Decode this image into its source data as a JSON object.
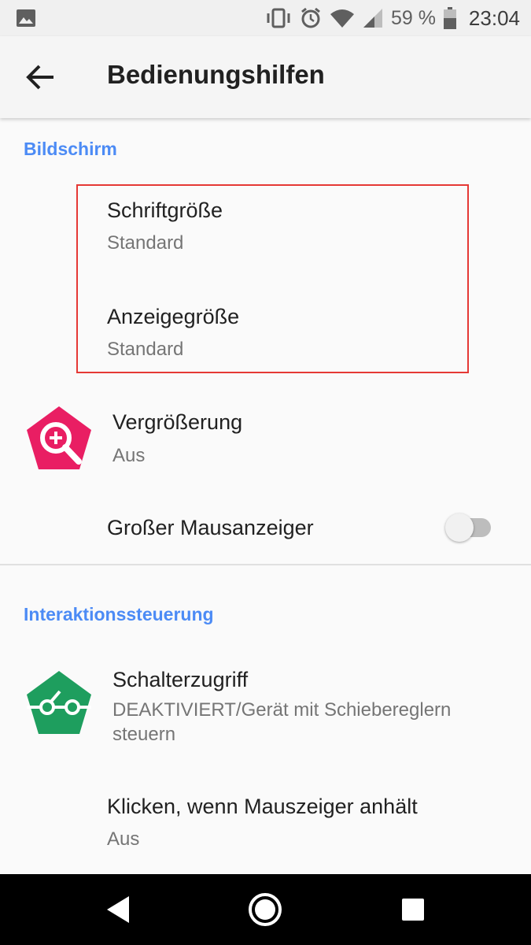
{
  "status_bar": {
    "battery_percent": "59 %",
    "time": "23:04",
    "icons": [
      "gallery-icon",
      "vibrate-icon",
      "alarm-icon",
      "wifi-icon",
      "signal-icon",
      "battery-icon"
    ]
  },
  "app_bar": {
    "title": "Bedienungshilfen",
    "back_icon": "arrow-back-icon"
  },
  "sections": {
    "display": {
      "header": "Bildschirm",
      "items": [
        {
          "title": "Schriftgröße",
          "summary": "Standard"
        },
        {
          "title": "Anzeigegröße",
          "summary": "Standard"
        },
        {
          "title": "Vergrößerung",
          "summary": "Aus",
          "icon": "magnification-icon",
          "icon_color": "#e91e63"
        },
        {
          "title": "Großer Mausanzeiger",
          "toggle": false
        }
      ]
    },
    "interaction": {
      "header": "Interaktionssteuerung",
      "items": [
        {
          "title": "Schalterzugriff",
          "summary": "DEAKTIVIERT/Gerät mit Schiebereglern steuern",
          "icon": "switch-access-icon",
          "icon_color": "#1e9e5e"
        },
        {
          "title": "Klicken, wenn Mauszeiger anhält",
          "summary": "Aus"
        }
      ]
    }
  },
  "nav_bar": {
    "buttons": [
      "back-triangle-icon",
      "home-circle-icon",
      "recents-square-icon"
    ]
  },
  "colors": {
    "accent": "#4c8bf5",
    "highlight_box": "#e53935",
    "nav_background": "#000000"
  }
}
